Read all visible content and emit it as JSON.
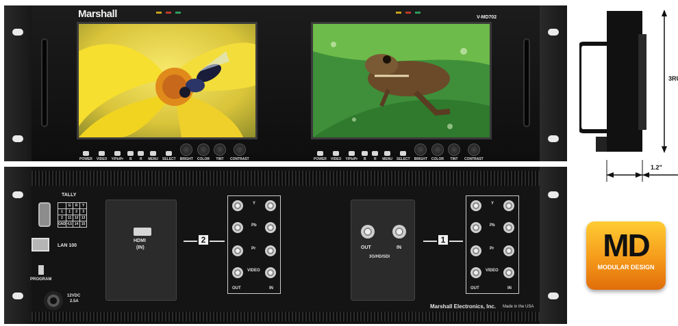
{
  "front_panel": {
    "brand": "Marshall",
    "model": "V-MD702",
    "led_colors": [
      "#c9a31c",
      "#c0392b",
      "#2e9e5b"
    ],
    "monitor_left_controls": [
      "POWER",
      "VIDEO",
      "Y/Pb/Pr",
      "B",
      "R",
      "MENU",
      "SELECT",
      "BRIGHT",
      "COLOR",
      "TINT",
      "CONTRAST"
    ],
    "monitor_right_controls": [
      "POWER",
      "VIDEO",
      "Y/Pb/Pr",
      "B",
      "R",
      "MENU",
      "SELECT",
      "BRIGHT",
      "COLOR",
      "TINT",
      "CONTRAST"
    ]
  },
  "rear_panel": {
    "tally_label": "TALLY",
    "tally_rows": [
      [
        "",
        "G",
        "R",
        "Y"
      ],
      [
        "1",
        "1",
        "2",
        "3"
      ],
      [
        "2",
        "11",
        "12",
        "13"
      ],
      [
        "GND",
        "4,5",
        "14",
        "15"
      ]
    ],
    "lan_label": "LAN 100",
    "program_label": "PROGRAM",
    "power_label_1": "12VDC",
    "power_label_2": "2.5A",
    "module_2": {
      "number": "2",
      "hdmi_label": "HDMI",
      "hdmi_sub": "(IN)",
      "row_labels": [
        "Y",
        "Pb",
        "Pr",
        "VIDEO"
      ],
      "out_label": "OUT",
      "in_label": "IN"
    },
    "module_1": {
      "number": "1",
      "out_label": "OUT",
      "in_label": "IN",
      "sdi_label": "3G/HD/SDI",
      "row_labels": [
        "Y",
        "Pb",
        "Pr",
        "VIDEO"
      ],
      "bnc_out_label": "OUT",
      "bnc_in_label": "IN"
    },
    "maker": "Marshall Electronics, Inc.",
    "made_in": "Made in the USA"
  },
  "side_view": {
    "height_label": "3RU",
    "depth_label": "1.2\""
  },
  "badge": {
    "title": "MD",
    "subtitle": "MODULAR DESIGN"
  }
}
